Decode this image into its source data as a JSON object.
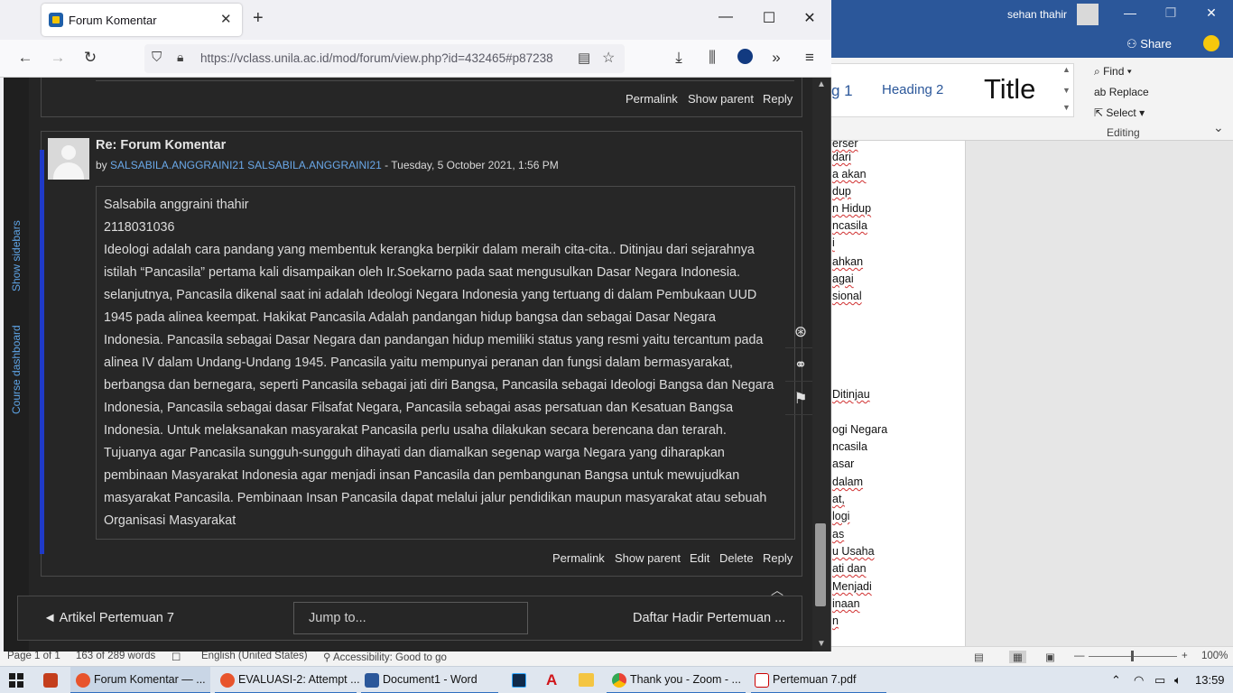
{
  "word": {
    "user_name": "sehan thahir",
    "share_label": "Share",
    "styles": [
      "g 1",
      "Heading 2",
      "Title"
    ],
    "editing": {
      "find": "Find",
      "replace": "Replace",
      "select": "Select",
      "group_label": "Editing"
    },
    "doc_fragments": [
      "erser",
      "dari",
      "a akan",
      "dup",
      "n Hidup",
      "ncasila",
      "i",
      "ahkan",
      "agai",
      "sional",
      "Ditinjau",
      "ogi Negara",
      "ncasila",
      "asar",
      "dalam",
      "at,",
      "logi",
      "as",
      "u Usaha",
      "ati dan",
      "Menjadi",
      "inaan",
      "n"
    ],
    "status": {
      "page": "Page 1 of 1",
      "words": "163 of 289 words",
      "language": "English (United States)",
      "accessibility": "Accessibility: Good to go",
      "zoom": "100%"
    }
  },
  "browser": {
    "tab_title": "Forum Komentar",
    "url": "https://vclass.unila.ac.id/mod/forum/view.php?id=432465#p87238"
  },
  "sidebar": {
    "show_sidebars": "Show sidebars",
    "course_dashboard": "Course dashboard"
  },
  "prev_post": {
    "permalink": "Permalink",
    "show_parent": "Show parent",
    "reply": "Reply"
  },
  "post": {
    "subject": "Re: Forum Komentar",
    "by": "by",
    "author": "SALSABILA.ANGGRAINI21 SALSABILA.ANGGRAINI21",
    "date": " - Tuesday, 5 October 2021, 1:56 PM",
    "lines": [
      "Salsabila anggraini thahir",
      "2118031036",
      "Ideologi adalah cara pandang yang membentuk kerangka berpikir dalam meraih cita-cita.. Ditinjau dari sejarahnya",
      "istilah “Pancasila” pertama kali disampaikan oleh Ir.Soekarno pada saat mengusulkan Dasar Negara Indonesia.",
      "selanjutnya, Pancasila dikenal saat ini adalah Ideologi Negara Indonesia yang tertuang di dalam Pembukaan UUD",
      "1945 pada alinea keempat. Hakikat Pancasila Adalah pandangan hidup bangsa dan sebagai Dasar Negara",
      "Indonesia. Pancasila sebagai Dasar Negara dan pandangan hidup memiliki status yang resmi yaitu tercantum pada",
      "alinea IV dalam Undang-Undang 1945. Pancasila yaitu mempunyai peranan dan fungsi dalam bermasyarakat,",
      "berbangsa dan bernegara, seperti Pancasila sebagai jati diri Bangsa, Pancasila sebagai Ideologi Bangsa dan Negara",
      "Indonesia, Pancasila sebagai dasar Filsafat Negara, Pancasila sebagai asas persatuan dan Kesatuan Bangsa",
      "Indonesia. Untuk melaksanakan masyarakat Pancasila perlu usaha dilakukan secara berencana dan terarah.",
      "Tujuanya agar Pancasila sungguh-sungguh dihayati dan diamalkan segenap warga Negara yang diharapkan",
      "pembinaan Masyarakat Indonesia agar menjadi insan Pancasila dan pembangunan Bangsa untuk mewujudkan",
      "masyarakat Pancasila. Pembinaan Insan Pancasila dapat melalui jalur pendidikan maupun masyarakat atau sebuah",
      "Organisasi Masyarakat"
    ],
    "actions": {
      "permalink": "Permalink",
      "show_parent": "Show parent",
      "edit": "Edit",
      "delete": "Delete",
      "reply": "Reply"
    }
  },
  "navigation": {
    "prev": "◄ Artikel Pertemuan 7",
    "jump_placeholder": "Jump to...",
    "next": "Daftar Hadir Pertemuan ..."
  },
  "taskbar": {
    "items": [
      "Forum Komentar — ...",
      "EVALUASI-2: Attempt ...",
      "Document1 - Word",
      "Thank you - Zoom - ...",
      "Pertemuan 7.pdf"
    ],
    "time": "13:59"
  }
}
